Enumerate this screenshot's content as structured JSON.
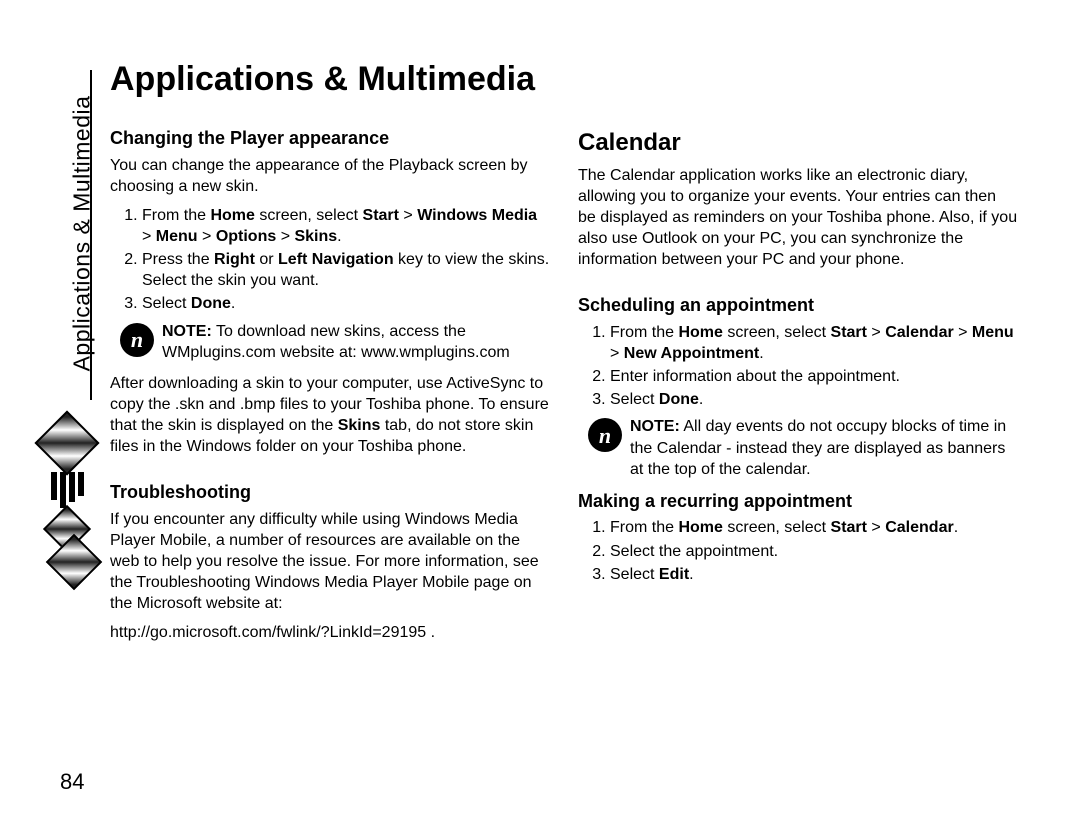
{
  "sideLabel": "Applications & Multimedia",
  "title": "Applications & Multimedia",
  "pageNumber": "84",
  "left": {
    "s1": {
      "heading": "Changing the Player appearance",
      "intro": "You can change the appearance of the Playback screen by choosing a new skin.",
      "li1a": "From the ",
      "li1b": "Home",
      "li1c": " screen, select ",
      "li1d": "Start",
      "li1e": " > ",
      "li1f": "Windows Media",
      "li1g": " > ",
      "li1h": "Menu",
      "li1i": " > ",
      "li1j": "Options",
      "li1k": " > ",
      "li1l": "Skins",
      "li1m": ".",
      "li2a": "Press the ",
      "li2b": "Right",
      "li2c": " or ",
      "li2d": "Left Navigation",
      "li2e": " key to view the skins. Select the skin you want.",
      "li3a": "Select ",
      "li3b": "Done",
      "li3c": ".",
      "noteLabel": "NOTE:",
      "noteText": " To download new skins, access the WMplugins.com website at: www.wmplugins.com",
      "after": "After downloading a skin to your computer, use ActiveSync to copy the .skn and .bmp files to your Toshiba phone. To ensure that the skin is displayed on the ",
      "afterB": "Skins",
      "after2": " tab, do not store skin files in the Windows folder on your Toshiba phone."
    },
    "s2": {
      "heading": "Troubleshooting",
      "para": "If you encounter any difficulty while using Windows Media Player Mobile, a number of resources are available on the web to help you resolve the issue. For more information, see the Troubleshooting Windows Media Player Mobile page on the Microsoft website at:",
      "url": "http://go.microsoft.com/fwlink/?LinkId=29195 ."
    }
  },
  "right": {
    "heading": "Calendar",
    "intro": "The Calendar application works like an electronic diary, allowing you to organize your events. Your entries can then be displayed as reminders on your Toshiba phone. Also, if you also use Outlook on your PC, you can synchronize the information between your PC and your phone.",
    "s1": {
      "heading": "Scheduling an appointment",
      "li1a": "From the ",
      "li1b": "Home",
      "li1c": " screen, select ",
      "li1d": "Start",
      "li1e": " > ",
      "li1f": "Calendar",
      "li1g": " > ",
      "li1h": "Menu",
      "li1i": " > ",
      "li1j": "New Appointment",
      "li1k": ".",
      "li2": "Enter information about the appointment.",
      "li3a": "Select ",
      "li3b": "Done",
      "li3c": ".",
      "noteLabel": "NOTE:",
      "noteText": " All day events do not occupy blocks of time in the Calendar - instead they are displayed as banners at the top of the calendar."
    },
    "s2": {
      "heading": "Making a recurring appointment",
      "li1a": "From the ",
      "li1b": "Home",
      "li1c": " screen, select ",
      "li1d": "Start",
      "li1e": " > ",
      "li1f": "Calendar",
      "li1g": ".",
      "li2": "Select the appointment.",
      "li3a": "Select ",
      "li3b": "Edit",
      "li3c": "."
    }
  }
}
